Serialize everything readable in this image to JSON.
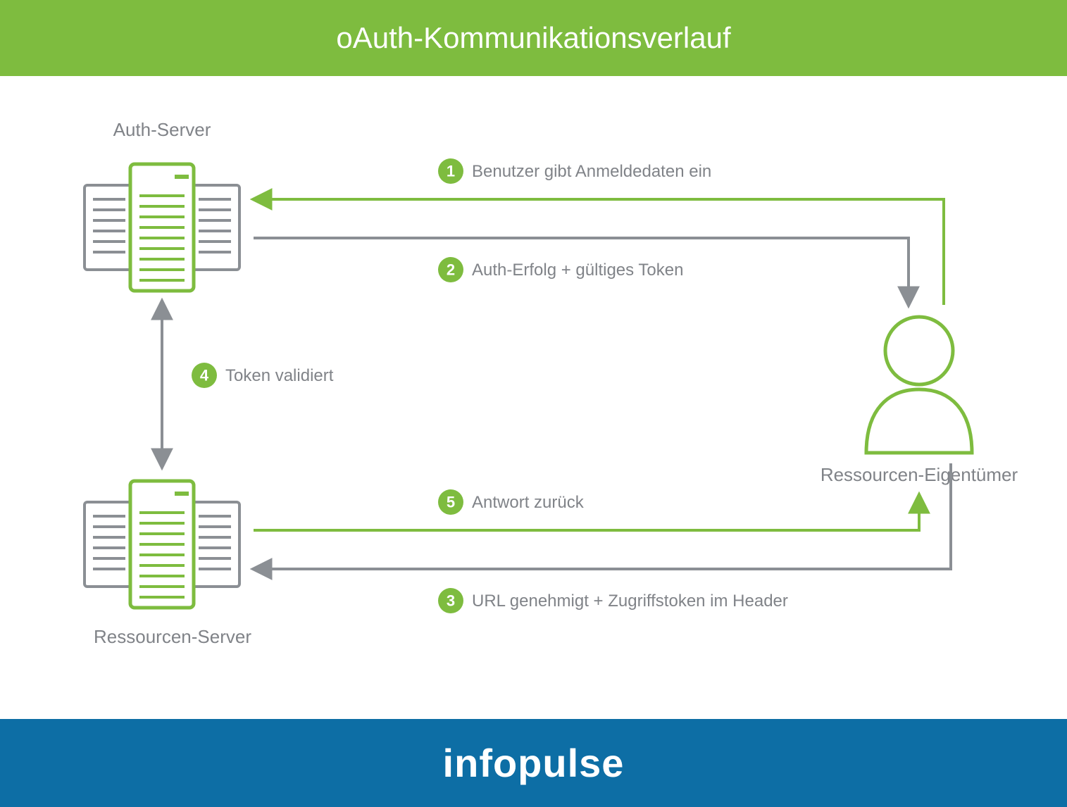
{
  "title": "oAuth-Kommunikationsverlauf",
  "footer": "infopulse",
  "nodes": {
    "auth_server": "Auth-Server",
    "resource_server": "Ressourcen-Server",
    "resource_owner": "Ressourcen-Eigentümer"
  },
  "steps": {
    "s1": {
      "num": "1",
      "label": "Benutzer gibt Anmeldedaten ein"
    },
    "s2": {
      "num": "2",
      "label": "Auth-Erfolg + gültiges Token"
    },
    "s3": {
      "num": "3",
      "label": "URL genehmigt + Zugriffstoken im Header"
    },
    "s4": {
      "num": "4",
      "label": "Token validiert"
    },
    "s5": {
      "num": "5",
      "label": "Antwort zurück"
    }
  },
  "colors": {
    "green": "#7EBC3F",
    "gray": "#8B8F94",
    "blue": "#0D6EA5"
  }
}
